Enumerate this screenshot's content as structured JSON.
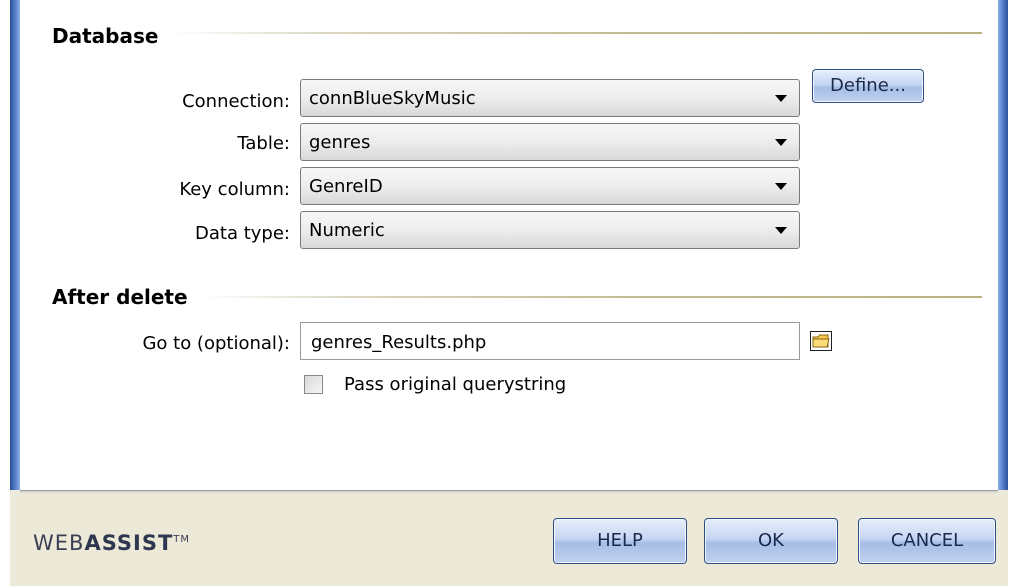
{
  "database": {
    "title": "Database",
    "connection": {
      "label": "Connection:",
      "value": "connBlueSkyMusic",
      "define_label": "Define..."
    },
    "table": {
      "label": "Table:",
      "value": "genres"
    },
    "key_column": {
      "label": "Key column:",
      "value": "GenreID"
    },
    "data_type": {
      "label": "Data type:",
      "value": "Numeric"
    }
  },
  "after_delete": {
    "title": "After delete",
    "goto": {
      "label": "Go to (optional):",
      "value": "genres_Results.php",
      "browse_icon": "folder-icon"
    },
    "pass_querystring": {
      "label": "Pass original querystring",
      "checked": false
    }
  },
  "footer": {
    "logo_light": "WEB",
    "logo_bold": "ASSIST",
    "logo_tm": "TM",
    "help_label": "HELP",
    "ok_label": "OK",
    "cancel_label": "CANCEL"
  },
  "colors": {
    "window_blue": "#2b4f9b",
    "button_gradient_top": "#e6eefb",
    "button_gradient_mid": "#a6bde6",
    "dialog_bg": "#ece9d8"
  }
}
